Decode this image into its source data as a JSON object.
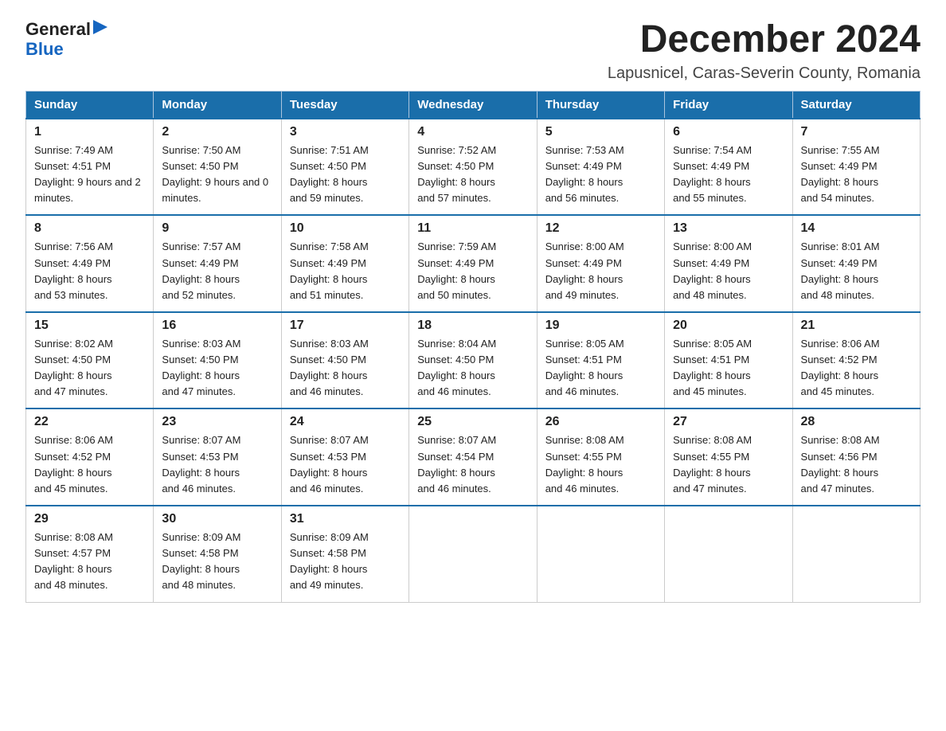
{
  "logo": {
    "general": "General",
    "blue": "Blue"
  },
  "title": "December 2024",
  "location": "Lapusnicel, Caras-Severin County, Romania",
  "headers": [
    "Sunday",
    "Monday",
    "Tuesday",
    "Wednesday",
    "Thursday",
    "Friday",
    "Saturday"
  ],
  "weeks": [
    [
      {
        "day": "1",
        "sunrise": "7:49 AM",
        "sunset": "4:51 PM",
        "daylight": "9 hours and 2 minutes."
      },
      {
        "day": "2",
        "sunrise": "7:50 AM",
        "sunset": "4:50 PM",
        "daylight": "9 hours and 0 minutes."
      },
      {
        "day": "3",
        "sunrise": "7:51 AM",
        "sunset": "4:50 PM",
        "daylight": "8 hours and 59 minutes."
      },
      {
        "day": "4",
        "sunrise": "7:52 AM",
        "sunset": "4:50 PM",
        "daylight": "8 hours and 57 minutes."
      },
      {
        "day": "5",
        "sunrise": "7:53 AM",
        "sunset": "4:49 PM",
        "daylight": "8 hours and 56 minutes."
      },
      {
        "day": "6",
        "sunrise": "7:54 AM",
        "sunset": "4:49 PM",
        "daylight": "8 hours and 55 minutes."
      },
      {
        "day": "7",
        "sunrise": "7:55 AM",
        "sunset": "4:49 PM",
        "daylight": "8 hours and 54 minutes."
      }
    ],
    [
      {
        "day": "8",
        "sunrise": "7:56 AM",
        "sunset": "4:49 PM",
        "daylight": "8 hours and 53 minutes."
      },
      {
        "day": "9",
        "sunrise": "7:57 AM",
        "sunset": "4:49 PM",
        "daylight": "8 hours and 52 minutes."
      },
      {
        "day": "10",
        "sunrise": "7:58 AM",
        "sunset": "4:49 PM",
        "daylight": "8 hours and 51 minutes."
      },
      {
        "day": "11",
        "sunrise": "7:59 AM",
        "sunset": "4:49 PM",
        "daylight": "8 hours and 50 minutes."
      },
      {
        "day": "12",
        "sunrise": "8:00 AM",
        "sunset": "4:49 PM",
        "daylight": "8 hours and 49 minutes."
      },
      {
        "day": "13",
        "sunrise": "8:00 AM",
        "sunset": "4:49 PM",
        "daylight": "8 hours and 48 minutes."
      },
      {
        "day": "14",
        "sunrise": "8:01 AM",
        "sunset": "4:49 PM",
        "daylight": "8 hours and 48 minutes."
      }
    ],
    [
      {
        "day": "15",
        "sunrise": "8:02 AM",
        "sunset": "4:50 PM",
        "daylight": "8 hours and 47 minutes."
      },
      {
        "day": "16",
        "sunrise": "8:03 AM",
        "sunset": "4:50 PM",
        "daylight": "8 hours and 47 minutes."
      },
      {
        "day": "17",
        "sunrise": "8:03 AM",
        "sunset": "4:50 PM",
        "daylight": "8 hours and 46 minutes."
      },
      {
        "day": "18",
        "sunrise": "8:04 AM",
        "sunset": "4:50 PM",
        "daylight": "8 hours and 46 minutes."
      },
      {
        "day": "19",
        "sunrise": "8:05 AM",
        "sunset": "4:51 PM",
        "daylight": "8 hours and 46 minutes."
      },
      {
        "day": "20",
        "sunrise": "8:05 AM",
        "sunset": "4:51 PM",
        "daylight": "8 hours and 45 minutes."
      },
      {
        "day": "21",
        "sunrise": "8:06 AM",
        "sunset": "4:52 PM",
        "daylight": "8 hours and 45 minutes."
      }
    ],
    [
      {
        "day": "22",
        "sunrise": "8:06 AM",
        "sunset": "4:52 PM",
        "daylight": "8 hours and 45 minutes."
      },
      {
        "day": "23",
        "sunrise": "8:07 AM",
        "sunset": "4:53 PM",
        "daylight": "8 hours and 46 minutes."
      },
      {
        "day": "24",
        "sunrise": "8:07 AM",
        "sunset": "4:53 PM",
        "daylight": "8 hours and 46 minutes."
      },
      {
        "day": "25",
        "sunrise": "8:07 AM",
        "sunset": "4:54 PM",
        "daylight": "8 hours and 46 minutes."
      },
      {
        "day": "26",
        "sunrise": "8:08 AM",
        "sunset": "4:55 PM",
        "daylight": "8 hours and 46 minutes."
      },
      {
        "day": "27",
        "sunrise": "8:08 AM",
        "sunset": "4:55 PM",
        "daylight": "8 hours and 47 minutes."
      },
      {
        "day": "28",
        "sunrise": "8:08 AM",
        "sunset": "4:56 PM",
        "daylight": "8 hours and 47 minutes."
      }
    ],
    [
      {
        "day": "29",
        "sunrise": "8:08 AM",
        "sunset": "4:57 PM",
        "daylight": "8 hours and 48 minutes."
      },
      {
        "day": "30",
        "sunrise": "8:09 AM",
        "sunset": "4:58 PM",
        "daylight": "8 hours and 48 minutes."
      },
      {
        "day": "31",
        "sunrise": "8:09 AM",
        "sunset": "4:58 PM",
        "daylight": "8 hours and 49 minutes."
      },
      null,
      null,
      null,
      null
    ]
  ]
}
